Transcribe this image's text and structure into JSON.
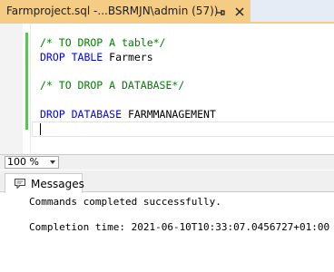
{
  "tab": {
    "title": "Farmproject.sql -...BSRMJN\\admin (57))",
    "pin_icon": "pin-icon",
    "close_icon": "close-icon",
    "active_color": "#f5cc84"
  },
  "editor": {
    "lines": [
      {
        "parts": [
          {
            "type": "comment",
            "text": "/* TO DROP A table*/"
          }
        ]
      },
      {
        "parts": [
          {
            "type": "keyword",
            "text": "DROP TABLE "
          },
          {
            "type": "text",
            "text": "Farmers"
          }
        ]
      },
      {
        "parts": []
      },
      {
        "parts": [
          {
            "type": "comment",
            "text": "/* TO DROP A DATABASE*/"
          }
        ]
      },
      {
        "parts": []
      },
      {
        "parts": [
          {
            "type": "keyword",
            "text": "DROP DATABASE "
          },
          {
            "type": "text",
            "text": "FARMMANAGEMENT"
          }
        ]
      }
    ]
  },
  "zoom": {
    "value": "100 %"
  },
  "results": {
    "tab_label": "Messages",
    "message": "Commands completed successfully.",
    "completion": "Completion time: 2021-06-10T10:33:07.0456727+01:00"
  }
}
